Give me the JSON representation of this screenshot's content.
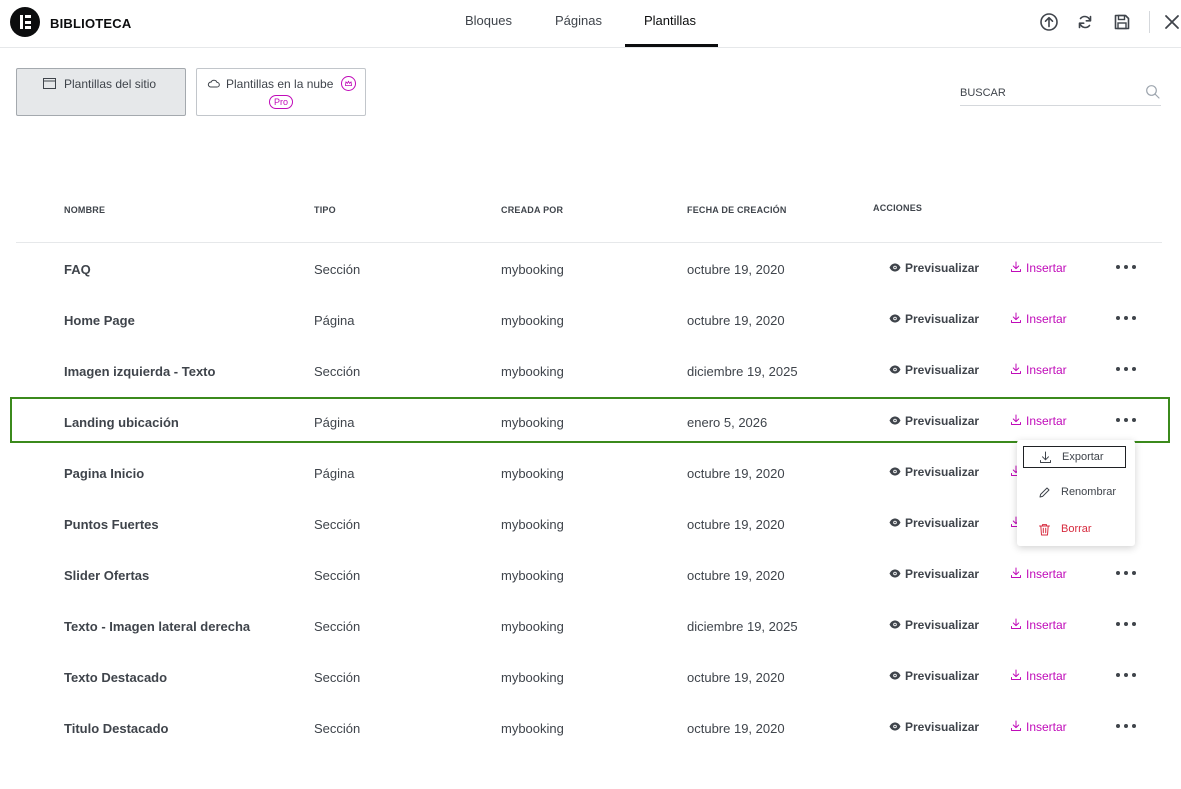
{
  "header": {
    "brand": "BIBLIOTECA",
    "tabs": [
      {
        "label": "Bloques"
      },
      {
        "label": "Páginas"
      },
      {
        "label": "Plantillas"
      }
    ],
    "active_tab": "Plantillas"
  },
  "filters": {
    "site_templates": "Plantillas del sitio",
    "cloud_templates": "Plantillas en la nube",
    "pro_badge": "Pro"
  },
  "search": {
    "placeholder": "BUSCAR"
  },
  "table": {
    "columns": {
      "name": "NOMBRE",
      "type": "TIPO",
      "author": "CREADA POR",
      "date": "FECHA DE CREACIÓN",
      "actions": "ACCIONES"
    },
    "preview_label": "Previsualizar",
    "insert_label": "Insertar",
    "rows": [
      {
        "name": "FAQ",
        "type": "Sección",
        "author": "mybooking",
        "date": "octubre 19, 2020"
      },
      {
        "name": "Home Page",
        "type": "Página",
        "author": "mybooking",
        "date": "octubre 19, 2020"
      },
      {
        "name": "Imagen izquierda - Texto",
        "type": "Sección",
        "author": "mybooking",
        "date": "diciembre 19, 2025"
      },
      {
        "name": "Landing ubicación",
        "type": "Página",
        "author": "mybooking",
        "date": "enero 5, 2026"
      },
      {
        "name": "Pagina Inicio",
        "type": "Página",
        "author": "mybooking",
        "date": "octubre 19, 2020"
      },
      {
        "name": "Puntos Fuertes",
        "type": "Sección",
        "author": "mybooking",
        "date": "octubre 19, 2020"
      },
      {
        "name": "Slider Ofertas",
        "type": "Sección",
        "author": "mybooking",
        "date": "octubre 19, 2020"
      },
      {
        "name": "Texto - Imagen lateral derecha",
        "type": "Sección",
        "author": "mybooking",
        "date": "diciembre 19, 2025"
      },
      {
        "name": "Texto Destacado",
        "type": "Sección",
        "author": "mybooking",
        "date": "octubre 19, 2020"
      },
      {
        "name": "Titulo Destacado",
        "type": "Sección",
        "author": "mybooking",
        "date": "octubre 19, 2020"
      }
    ]
  },
  "context_menu": {
    "export": "Exportar",
    "rename": "Renombrar",
    "delete": "Borrar"
  },
  "colors": {
    "accent": "#c00bb9",
    "highlight_border": "#3b8a1c",
    "delete": "#d72b3f"
  }
}
